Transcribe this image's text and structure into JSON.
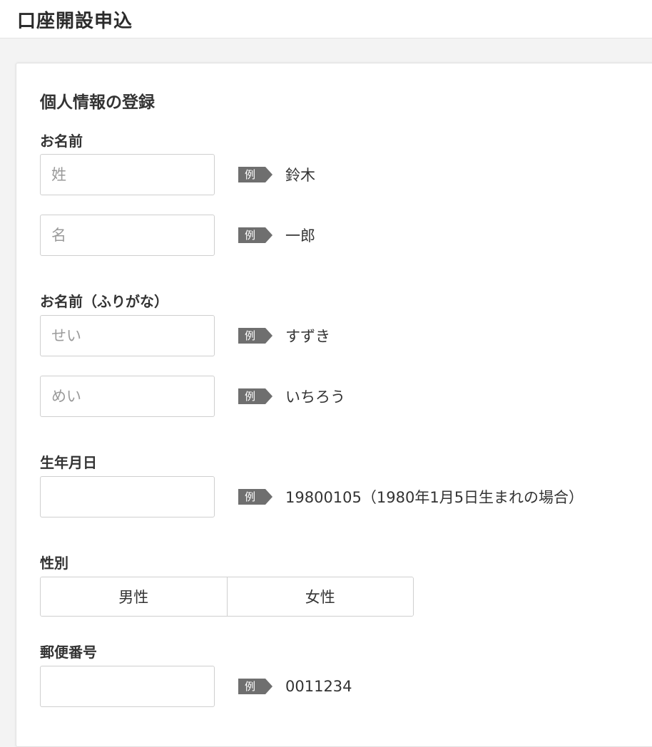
{
  "header": {
    "title": "口座開設申込"
  },
  "form": {
    "section_title": "個人情報の登録",
    "example_tag": "例",
    "name": {
      "label": "お名前",
      "last": {
        "placeholder": "姓",
        "example": "鈴木"
      },
      "first": {
        "placeholder": "名",
        "example": "一郎"
      }
    },
    "kana": {
      "label": "お名前（ふりがな）",
      "last": {
        "placeholder": "せい",
        "example": "すずき"
      },
      "first": {
        "placeholder": "めい",
        "example": "いちろう"
      }
    },
    "birthdate": {
      "label": "生年月日",
      "example": "19800105（1980年1月5日生まれの場合）"
    },
    "gender": {
      "label": "性別",
      "options": [
        "男性",
        "女性"
      ]
    },
    "postal": {
      "label": "郵便番号",
      "example": "0011234"
    }
  }
}
